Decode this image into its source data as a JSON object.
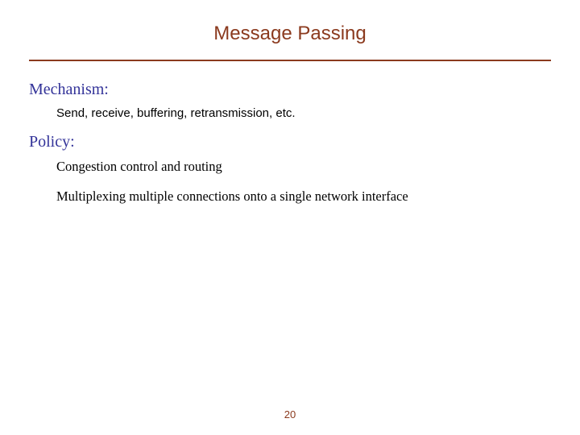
{
  "title": "Message Passing",
  "sections": [
    {
      "heading": "Mechanism:",
      "items": [
        {
          "text": "Send, receive, buffering, retransmission, etc.",
          "font": "sans"
        }
      ]
    },
    {
      "heading": "Policy:",
      "items": [
        {
          "text": "Congestion control and routing",
          "font": "serif"
        },
        {
          "text": "Multiplexing multiple connections onto a single network interface",
          "font": "serif"
        }
      ]
    }
  ],
  "page_number": "20",
  "colors": {
    "accent": "#8b3a1e",
    "heading": "#333399"
  }
}
